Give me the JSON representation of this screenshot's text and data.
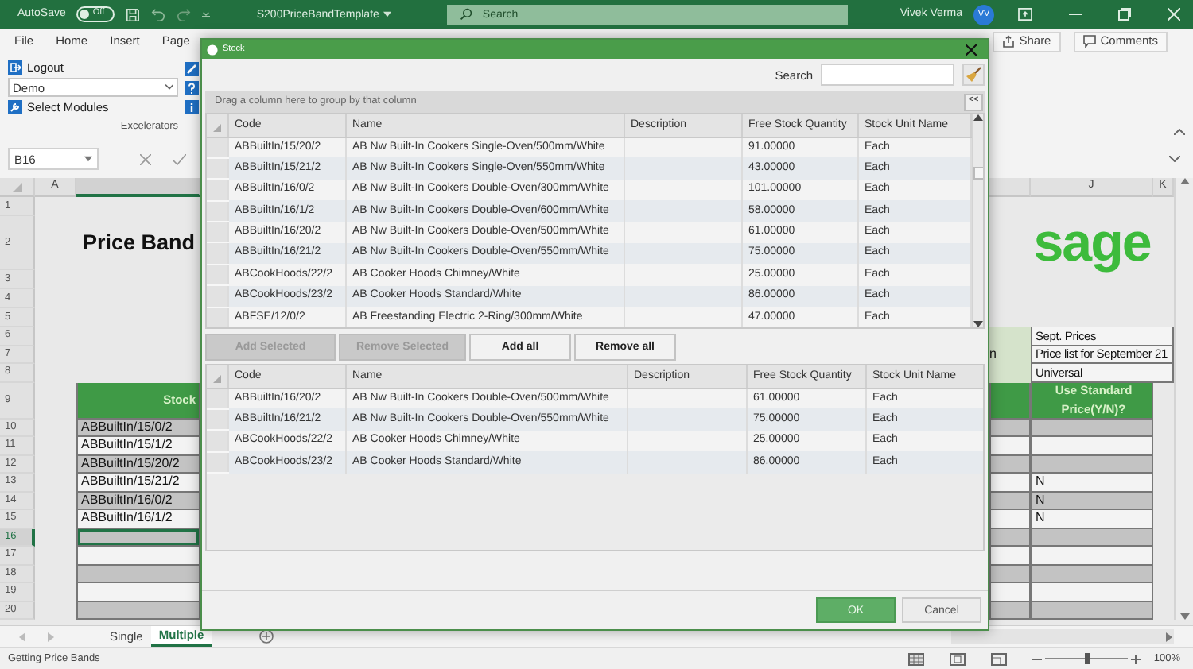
{
  "titlebar": {
    "autosave": {
      "label": "AutoSave",
      "state": "Off",
      "on": false
    },
    "filename": "S200PriceBandTemplate",
    "search_placeholder": "Search",
    "user": "Vivek Verma",
    "avatar": "VV"
  },
  "ribbon": {
    "tabs": [
      "File",
      "Home",
      "Insert",
      "Page"
    ],
    "share": "Share",
    "comments": "Comments",
    "logout": "Logout",
    "company": "Demo",
    "select_modules": "Select Modules",
    "group_label": "Excelerators"
  },
  "formula_bar": {
    "name_box": "B16"
  },
  "sheet": {
    "columns": [
      "A",
      "J",
      "K"
    ],
    "rows": [
      {
        "number": "1",
        "kind": "blank"
      },
      {
        "number": "2",
        "kind": "title",
        "b": "Price Band",
        "j": "sage"
      },
      {
        "number": "3",
        "kind": "blank"
      },
      {
        "number": "4",
        "kind": "blank"
      },
      {
        "number": "5",
        "kind": "blank"
      },
      {
        "number": "6",
        "kind": "info",
        "j": "Sept. Prices"
      },
      {
        "number": "7",
        "kind": "info",
        "i": "n",
        "j": "Price list for September 21"
      },
      {
        "number": "8",
        "kind": "info",
        "j": "Universal"
      },
      {
        "number": "9",
        "kind": "header",
        "b": "Stock",
        "j": "Use Standard Price(Y/N)?"
      },
      {
        "number": "10",
        "kind": "entry",
        "b": "ABBuiltIn/15/0/2",
        "selected": false
      },
      {
        "number": "11",
        "kind": "entry",
        "b": "ABBuiltIn/15/1/2",
        "selected": false
      },
      {
        "number": "12",
        "kind": "entry",
        "b": "ABBuiltIn/15/20/2",
        "selected": false
      },
      {
        "number": "13",
        "kind": "entry",
        "b": "ABBuiltIn/15/21/2",
        "j": "N",
        "selected": false
      },
      {
        "number": "14",
        "kind": "entry",
        "b": "ABBuiltIn/16/0/2",
        "j": "N",
        "selected": false
      },
      {
        "number": "15",
        "kind": "entry",
        "b": "ABBuiltIn/16/1/2",
        "j": "N",
        "selected": false
      },
      {
        "number": "16",
        "kind": "entry",
        "selected": true
      },
      {
        "number": "17",
        "kind": "entry",
        "selected": false
      },
      {
        "number": "18",
        "kind": "entry",
        "selected": false
      },
      {
        "number": "19",
        "kind": "entry",
        "selected": false
      },
      {
        "number": "20",
        "kind": "entry",
        "selected": false
      }
    ]
  },
  "sheet_tabs": [
    {
      "label": "Single",
      "selected": false
    },
    {
      "label": "Multiple",
      "selected": true
    }
  ],
  "status_bar": {
    "message": "Getting Price Bands",
    "zoom": "100%",
    "zoom_slider": {
      "level": 0.5
    }
  },
  "dialog": {
    "title": "Stock",
    "search_label": "Search",
    "group_hint": "Drag a column here to group by that column",
    "collapse": "<<",
    "columns": [
      "Code",
      "Name",
      "Description",
      "Free Stock Quantity",
      "Stock Unit Name"
    ],
    "available": [
      {
        "code": "ABBuiltIn/15/20/2",
        "name": "AB Nw Built-In Cookers Single-Oven/500mm/White",
        "quantity": "91.00000",
        "unit": "Each"
      },
      {
        "code": "ABBuiltIn/15/21/2",
        "name": "AB Nw Built-In Cookers Single-Oven/550mm/White",
        "quantity": "43.00000",
        "unit": "Each"
      },
      {
        "code": "ABBuiltIn/16/0/2",
        "name": "AB Nw Built-In Cookers Double-Oven/300mm/White",
        "quantity": "101.00000",
        "unit": "Each"
      },
      {
        "code": "ABBuiltIn/16/1/2",
        "name": "AB Nw Built-In Cookers Double-Oven/600mm/White",
        "quantity": "58.00000",
        "unit": "Each"
      },
      {
        "code": "ABBuiltIn/16/20/2",
        "name": "AB Nw Built-In Cookers Double-Oven/500mm/White",
        "quantity": "61.00000",
        "unit": "Each"
      },
      {
        "code": "ABBuiltIn/16/21/2",
        "name": "AB Nw Built-In Cookers Double-Oven/550mm/White",
        "quantity": "75.00000",
        "unit": "Each"
      },
      {
        "code": "ABCookHoods/22/2",
        "name": "AB Cooker Hoods Chimney/White",
        "quantity": "25.00000",
        "unit": "Each"
      },
      {
        "code": "ABCookHoods/23/2",
        "name": "AB Cooker Hoods Standard/White",
        "quantity": "86.00000",
        "unit": "Each"
      },
      {
        "code": "ABFSE/12/0/2",
        "name": "AB Freestanding Electric 2-Ring/300mm/White",
        "quantity": "47.00000",
        "unit": "Each"
      }
    ],
    "actions": [
      {
        "label": "Add Selected",
        "disabled": true
      },
      {
        "label": "Remove Selected",
        "disabled": true
      },
      {
        "label": "Add all",
        "disabled": false
      },
      {
        "label": "Remove all",
        "disabled": false
      }
    ],
    "chosen_columns": [
      "Code",
      "Name",
      "Description",
      "Free Stock Quantity",
      "Stock Unit Name"
    ],
    "chosen": [
      {
        "code": "ABBuiltIn/16/20/2",
        "name": "AB Nw Built-In Cookers Double-Oven/500mm/White",
        "quantity": "61.00000",
        "unit": "Each"
      },
      {
        "code": "ABBuiltIn/16/21/2",
        "name": "AB Nw Built-In Cookers Double-Oven/550mm/White",
        "quantity": "75.00000",
        "unit": "Each"
      },
      {
        "code": "ABCookHoods/22/2",
        "name": "AB Cooker Hoods Chimney/White",
        "quantity": "25.00000",
        "unit": "Each"
      },
      {
        "code": "ABCookHoods/23/2",
        "name": "AB Cooker Hoods Standard/White",
        "quantity": "86.00000",
        "unit": "Each"
      }
    ],
    "buttons": [
      {
        "label": "OK",
        "default": true
      },
      {
        "label": "Cancel",
        "default": false
      }
    ]
  }
}
